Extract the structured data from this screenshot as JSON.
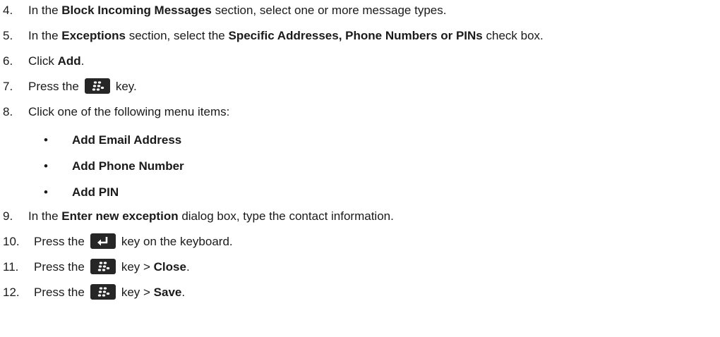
{
  "steps": [
    {
      "num": "4.",
      "pre": "In the ",
      "b1": "Block Incoming Messages",
      "post": " section, select one or more message types."
    },
    {
      "num": "5.",
      "pre": "In the ",
      "b1": "Exceptions",
      "mid": " section, select the ",
      "b2": "Specific Addresses, Phone Numbers or PINs",
      "post": " check box."
    },
    {
      "num": "6.",
      "pre": "Click ",
      "b1": "Add",
      "post": "."
    },
    {
      "num": "7.",
      "pre": "Press the",
      "post": "key."
    },
    {
      "num": "8.",
      "text": "Click one of the following menu items:"
    },
    {
      "num": "9.",
      "pre": "In the ",
      "b1": "Enter new exception",
      "post": " dialog box, type the contact information."
    },
    {
      "num": "10.",
      "pre": "Press the",
      "post": "key on the keyboard."
    },
    {
      "num": "11.",
      "pre": "Press the",
      "mid": "key > ",
      "b1": "Close",
      "post": "."
    },
    {
      "num": "12.",
      "pre": "Press the",
      "mid": "key > ",
      "b1": "Save",
      "post": "."
    }
  ],
  "bullets": {
    "symbol": "•",
    "items": [
      "Add Email Address",
      "Add Phone Number",
      "Add PIN"
    ]
  },
  "icons": {
    "menu_key": "blackberry-menu-key-icon",
    "enter_key": "enter-key-icon"
  },
  "colors": {
    "text": "#1a1a1a",
    "key_background": "#262626",
    "key_glyph": "#ffffff"
  }
}
